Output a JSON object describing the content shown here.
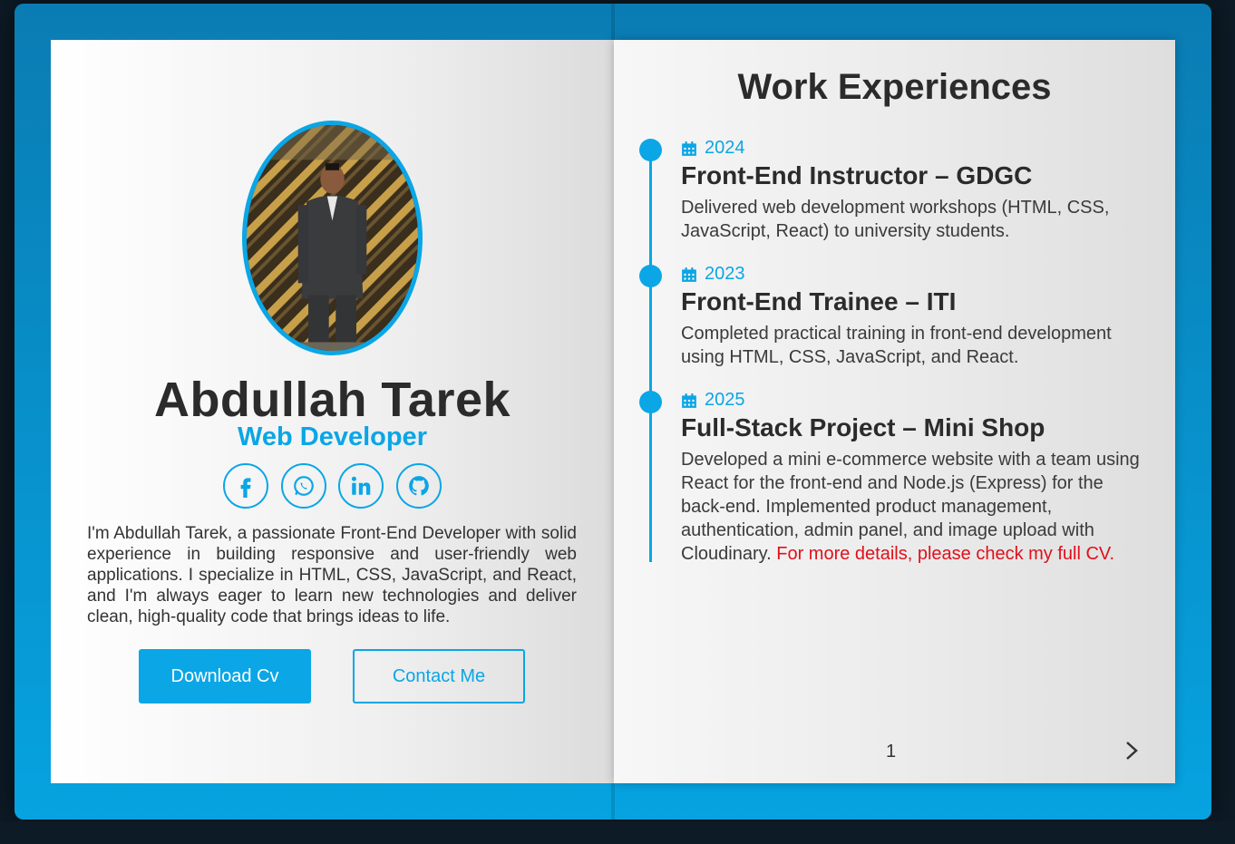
{
  "profile": {
    "name": "Abdullah Tarek",
    "role": "Web Developer",
    "bio": "I'm Abdullah Tarek, a passionate Front-End Developer with solid experience in building responsive and user-friendly web applications. I specialize in HTML, CSS, JavaScript, and React, and I'm always eager to learn new technologies and deliver clean, high-quality code that brings ideas to life.",
    "socials": [
      {
        "icon": "facebook-icon"
      },
      {
        "icon": "whatsapp-icon"
      },
      {
        "icon": "linkedin-icon"
      },
      {
        "icon": "github-icon"
      }
    ],
    "buttons": {
      "download": "Download Cv",
      "contact": "Contact Me"
    }
  },
  "experience": {
    "title": "Work Experiences",
    "entries": [
      {
        "year": "2024",
        "title": "Front-End Instructor – GDGC",
        "description": "Delivered web development workshops (HTML, CSS, JavaScript, React) to university students."
      },
      {
        "year": "2023",
        "title": "Front-End Trainee – ITI",
        "description": "Completed practical training in front-end development using HTML, CSS, JavaScript, and React."
      },
      {
        "year": "2025",
        "title": "Full-Stack Project – Mini Shop",
        "description": "Developed a mini e-commerce website with a team using React for the front-end and Node.js (Express) for the back-end. Implemented product management, authentication, admin panel, and image upload with Cloudinary.",
        "note": "For more details, please check my full CV."
      }
    ]
  },
  "pagination": {
    "page": "1"
  },
  "colors": {
    "accent": "#0aa6e6",
    "note": "#e0101a",
    "text": "#2b2b2b"
  }
}
